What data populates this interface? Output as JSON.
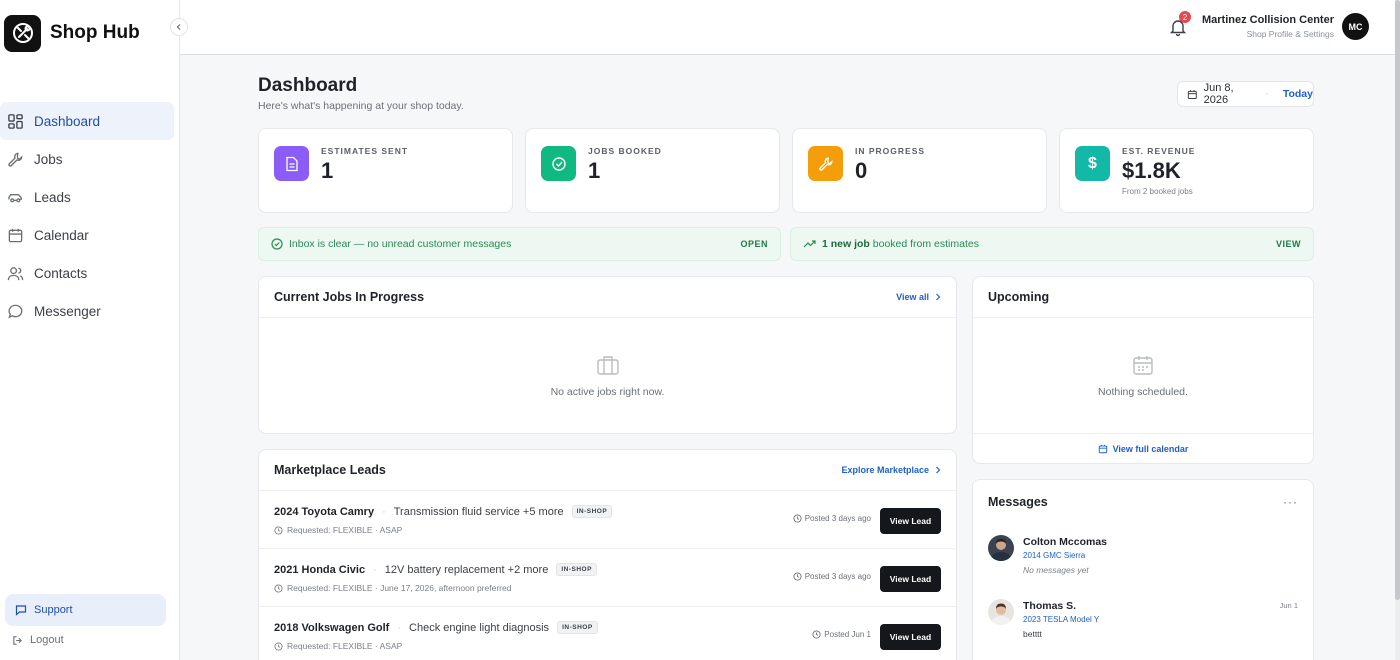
{
  "brand": {
    "name": "Shop Hub"
  },
  "sidebar": {
    "items": [
      {
        "label": "Dashboard",
        "icon": "dashboard-icon",
        "active": true
      },
      {
        "label": "Jobs",
        "icon": "wrench-icon"
      },
      {
        "label": "Leads",
        "icon": "car-icon"
      },
      {
        "label": "Calendar",
        "icon": "calendar-icon"
      },
      {
        "label": "Contacts",
        "icon": "users-icon"
      },
      {
        "label": "Messenger",
        "icon": "chat-icon"
      }
    ],
    "support_label": "Support",
    "logout_label": "Logout"
  },
  "topbar": {
    "notification_count": "2",
    "shop_name": "Martinez Collision Center",
    "shop_sub": "Shop Profile & Settings",
    "avatar_initials": "MC"
  },
  "page": {
    "title": "Dashboard",
    "subtitle": "Here's what's happening at your shop today.",
    "date": "Jun 8, 2026",
    "today_label": "Today"
  },
  "stats": [
    {
      "label": "ESTIMATES SENT",
      "value": "1",
      "color": "#8b5cf6",
      "icon": "document-icon"
    },
    {
      "label": "JOBS BOOKED",
      "value": "1",
      "color": "#10b981",
      "icon": "check-circle-icon"
    },
    {
      "label": "IN PROGRESS",
      "value": "0",
      "color": "#f59e0b",
      "icon": "wrench-icon"
    },
    {
      "label": "EST. REVENUE",
      "value": "$1.8K",
      "note": "From 2 booked jobs",
      "color": "#14b8a6",
      "icon": "dollar-icon"
    }
  ],
  "banners": {
    "inbox": {
      "text": "Inbox is clear — no unread customer messages",
      "action": "OPEN"
    },
    "jobs": {
      "strong": "1 new job",
      "text": "booked from estimates",
      "action": "VIEW"
    }
  },
  "current_jobs": {
    "title": "Current Jobs In Progress",
    "link": "View all",
    "empty": "No active jobs right now."
  },
  "upcoming": {
    "title": "Upcoming",
    "empty": "Nothing scheduled.",
    "link": "View full calendar"
  },
  "marketplace": {
    "title": "Marketplace Leads",
    "link": "Explore Marketplace",
    "button_label": "View Lead",
    "leads": [
      {
        "vehicle": "2024 Toyota Camry",
        "service": "Transmission fluid service +5 more",
        "tag": "IN-SHOP",
        "requested": "Requested: FLEXIBLE · ASAP",
        "posted": "Posted 3 days ago"
      },
      {
        "vehicle": "2021 Honda Civic",
        "service": "12V battery replacement +2 more",
        "tag": "IN-SHOP",
        "requested": "Requested: FLEXIBLE · June 17, 2026, afternoon preferred",
        "posted": "Posted 3 days ago"
      },
      {
        "vehicle": "2018 Volkswagen Golf",
        "service": "Check engine light diagnosis",
        "tag": "IN-SHOP",
        "requested": "Requested: FLEXIBLE · ASAP",
        "posted": "Posted Jun 1"
      }
    ]
  },
  "messages": {
    "title": "Messages",
    "items": [
      {
        "name": "Colton Mccomas",
        "vehicle": "2014 GMC Sierra",
        "text": "No messages yet",
        "time": "",
        "muted": true
      },
      {
        "name": "Thomas S.",
        "vehicle": "2023 TESLA Model Y",
        "text": "betttt",
        "time": "Jun 1",
        "muted": false
      }
    ]
  }
}
